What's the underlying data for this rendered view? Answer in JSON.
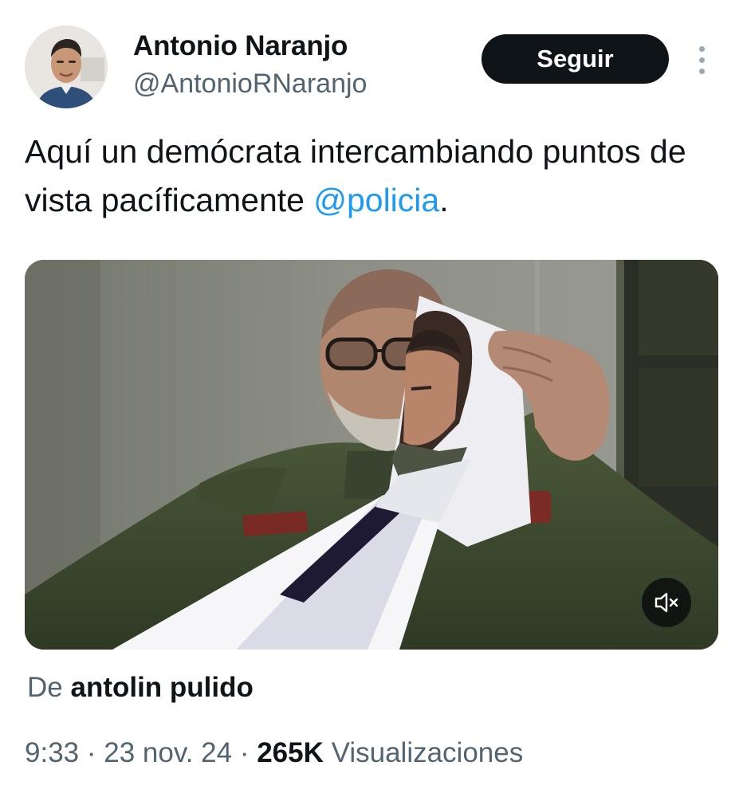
{
  "author": {
    "display_name": "Antonio Naranjo",
    "handle": "@AntonioRNaranjo"
  },
  "follow_button": {
    "label": "Seguir"
  },
  "more_menu": {
    "icon": "more-vertical-icon"
  },
  "tweet": {
    "text_before": "Aquí un demócrata intercambiando puntos de vista pacíficamente ",
    "mention": "@policia",
    "text_after": "."
  },
  "media": {
    "type": "video",
    "mute_icon": "volume-muted-icon"
  },
  "attribution": {
    "prefix": "De",
    "user": "antolin pulido"
  },
  "meta": {
    "time": "9:33",
    "separator": " · ",
    "date": "23 nov. 24",
    "views_count": "265K",
    "views_label": "Visualizaciones"
  },
  "colors": {
    "link": "#1d9bf0",
    "text_primary": "#0f1419",
    "text_secondary": "#536471",
    "button_bg": "#0f1419"
  }
}
